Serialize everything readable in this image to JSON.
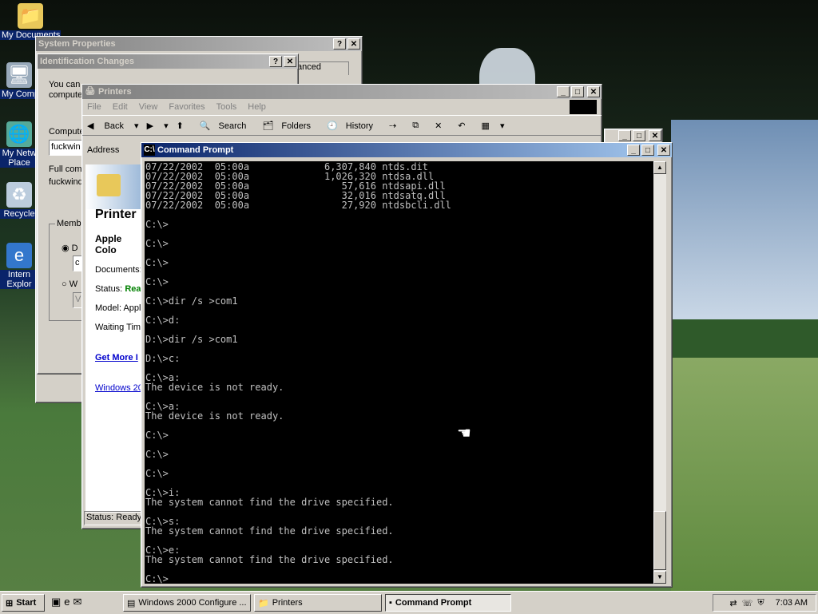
{
  "desktop": {
    "icons": [
      {
        "label": "My Documents",
        "icon": "folder-icon"
      },
      {
        "label": "My Comp",
        "icon": "computer-icon"
      },
      {
        "label": "My Netw",
        "label2": "Place",
        "icon": "network-icon"
      },
      {
        "label": "Recycle",
        "icon": "recycle-bin-icon"
      },
      {
        "label": "Intern",
        "label2": "Explor",
        "icon": "internet-explorer-icon"
      }
    ]
  },
  "system_properties": {
    "title": "System Properties",
    "tab_advanced": "anced"
  },
  "identification_changes": {
    "title": "Identification Changes",
    "desc1": "You can",
    "desc2": "compute",
    "computer_label": "Compute",
    "computer_value": "fuckwin",
    "full_label": "Full com",
    "full_value": "fuckwind",
    "member_label": "Memb",
    "radio1": "D",
    "field1": "c",
    "radio2": "W",
    "field2": "V"
  },
  "printers": {
    "title": "Printers",
    "menu": [
      "File",
      "Edit",
      "View",
      "Favorites",
      "Tools",
      "Help"
    ],
    "toolbar": {
      "back": "Back",
      "search": "Search",
      "folders": "Folders",
      "history": "History"
    },
    "address_label": "Address",
    "panel_title": "Printer",
    "printer_name": "Apple Colo",
    "documents": "Documents:",
    "status_label": "Status:",
    "status_value": "Rea",
    "model": "Model: Apple",
    "waiting": "Waiting Time",
    "get_more": "Get More I",
    "windows_link": "Windows 20",
    "statusbar": "Status: Ready"
  },
  "command_prompt": {
    "title": "Command Prompt",
    "lines": [
      "07/22/2002  05:00a             6,307,840 ntds.dit",
      "07/22/2002  05:00a             1,026,320 ntdsa.dll",
      "07/22/2002  05:00a                57,616 ntdsapi.dll",
      "07/22/2002  05:00a                32,016 ntdsatq.dll",
      "07/22/2002  05:00a                27,920 ntdsbcli.dll",
      "",
      "C:\\>",
      "",
      "C:\\>",
      "",
      "C:\\>",
      "",
      "C:\\>",
      "",
      "C:\\>dir /s >com1",
      "",
      "C:\\>d:",
      "",
      "D:\\>dir /s >com1",
      "",
      "D:\\>c:",
      "",
      "C:\\>a:",
      "The device is not ready.",
      "",
      "C:\\>a:",
      "The device is not ready.",
      "",
      "C:\\>",
      "",
      "C:\\>",
      "",
      "C:\\>",
      "",
      "C:\\>i:",
      "The system cannot find the drive specified.",
      "",
      "C:\\>s:",
      "The system cannot find the drive specified.",
      "",
      "C:\\>e:",
      "The system cannot find the drive specified.",
      "",
      "C:\\>_"
    ]
  },
  "taskbar": {
    "start": "Start",
    "tasks": [
      "Windows 2000 Configure ...",
      "Printers",
      "Command Prompt"
    ],
    "clock": "7:03 AM"
  },
  "colors": {
    "title_active": "#0a246a",
    "title_inactive": "#808080",
    "window_face": "#d4d0c8",
    "console_bg": "#000000",
    "console_fg": "#c0c0c0",
    "status_ready": "#008000",
    "link": "#0000cc"
  }
}
